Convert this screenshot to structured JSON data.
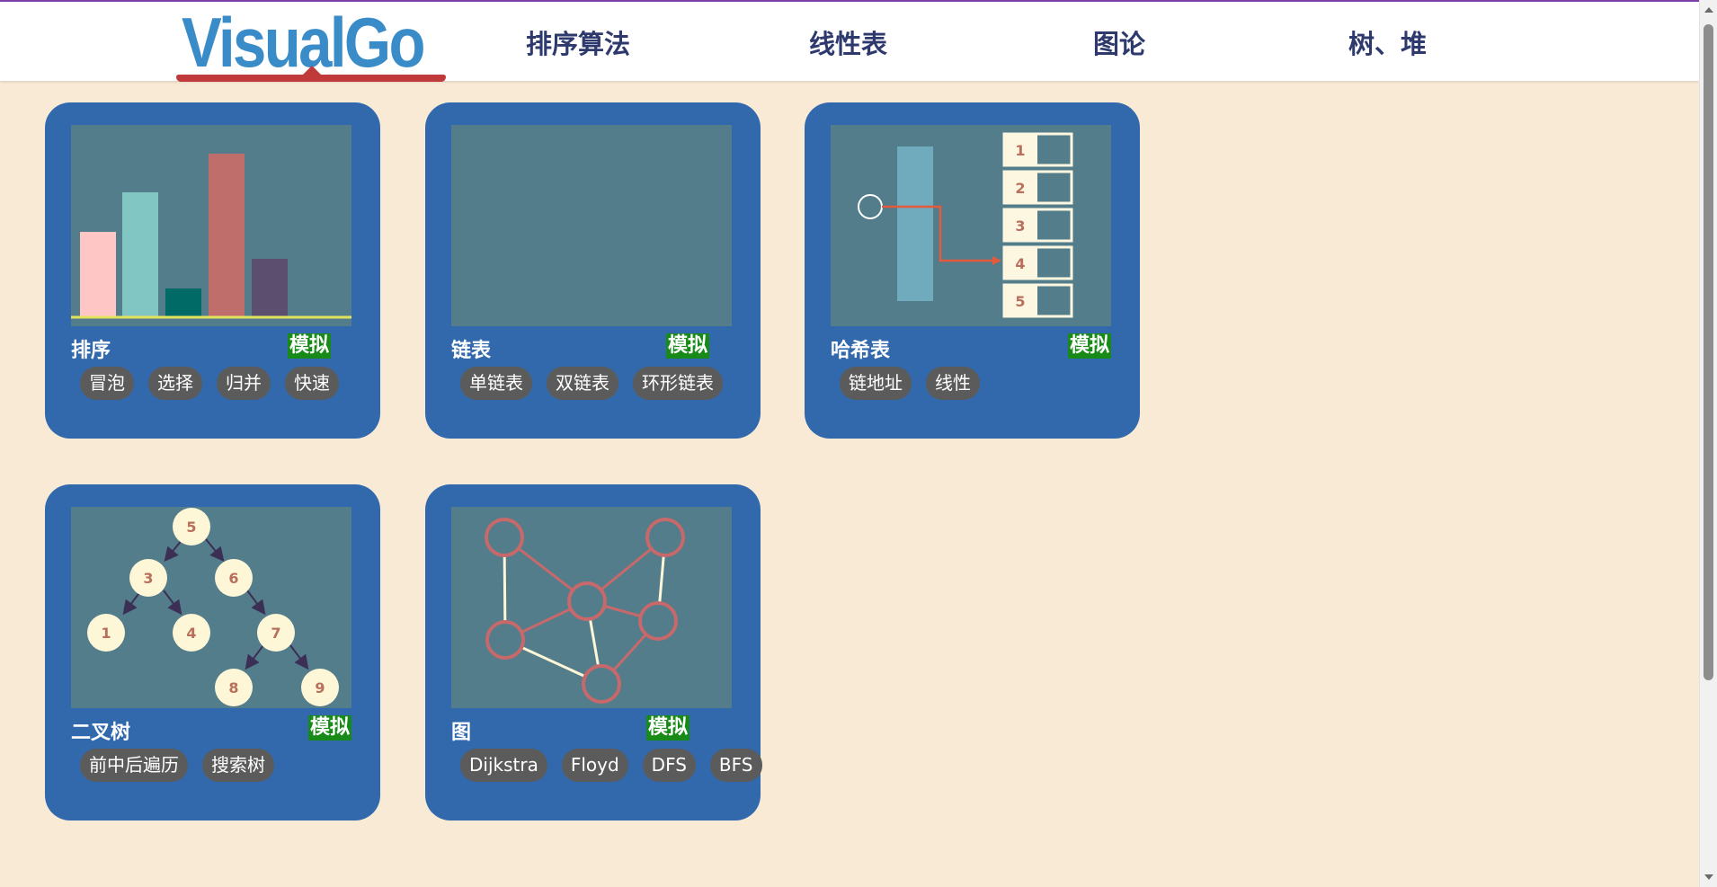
{
  "logo": {
    "text": "VisualGo"
  },
  "nav": {
    "items": [
      {
        "label": "排序算法"
      },
      {
        "label": "线性表"
      },
      {
        "label": "图论"
      },
      {
        "label": "树、堆"
      }
    ]
  },
  "sim_label": "模拟",
  "cards": [
    {
      "title": "排序",
      "tags": [
        "冒泡",
        "选择",
        "归并",
        "快速"
      ]
    },
    {
      "title": "链表",
      "tags": [
        "单链表",
        "双链表",
        "环形链表"
      ]
    },
    {
      "title": "哈希表",
      "tags": [
        "链地址",
        "线性"
      ],
      "slots": [
        "1",
        "2",
        "3",
        "4",
        "5"
      ]
    },
    {
      "title": "二叉树",
      "tags": [
        "前中后遍历",
        "搜索树"
      ],
      "nodes": [
        "5",
        "3",
        "6",
        "1",
        "4",
        "7",
        "8",
        "9"
      ]
    },
    {
      "title": "图",
      "tags": [
        "Dijkstra",
        "Floyd",
        "DFS",
        "BFS"
      ]
    }
  ],
  "colors": {
    "page_bg": "#f9ead6",
    "card_bg": "#3269ad",
    "thumb_bg": "#537d8a",
    "badge_bg": "#178a17",
    "tag_bg": "#5b5b5b",
    "nav_text": "#2e3a6e",
    "logo_blue": "#3a8cc8",
    "logo_red": "#c0393b"
  }
}
